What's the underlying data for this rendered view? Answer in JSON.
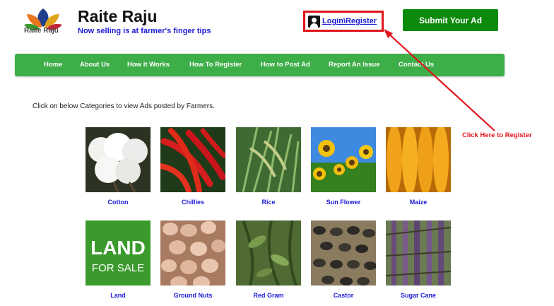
{
  "header": {
    "logo_text": "Raite Raju",
    "title": "Raite Raju",
    "tagline": "Now selling is at farmer's finger tips",
    "login_label": "Login\\Register",
    "submit_label": "Submit Your Ad"
  },
  "nav": {
    "items": [
      {
        "label": "Home"
      },
      {
        "label": "About Us"
      },
      {
        "label": "How it Works"
      },
      {
        "label": "How To Register"
      },
      {
        "label": "How to Post Ad"
      },
      {
        "label": "Report An Issue"
      },
      {
        "label": "Contact Us"
      }
    ]
  },
  "annotation": {
    "text": "Click Here to Register",
    "color": "#e0141b"
  },
  "main": {
    "intro": "Click on below Categories to view Ads posted by Farmers.",
    "categories": [
      {
        "label": "Cotton"
      },
      {
        "label": "Chillies"
      },
      {
        "label": "Rice"
      },
      {
        "label": "Sun Flower"
      },
      {
        "label": "Maize"
      },
      {
        "label": "Land",
        "image_text_1": "LAND",
        "image_text_2": "FOR SALE"
      },
      {
        "label": "Ground Nuts"
      },
      {
        "label": "Red Gram"
      },
      {
        "label": "Castor"
      },
      {
        "label": "Sugar Cane"
      }
    ]
  },
  "colors": {
    "nav_green": "#3dae48",
    "button_green": "#0c8a0c",
    "link_blue": "#1b1bd6",
    "highlight_red": "#e0141b"
  },
  "icons": {
    "login": "user-icon",
    "logo": "leaf-logo-icon"
  }
}
